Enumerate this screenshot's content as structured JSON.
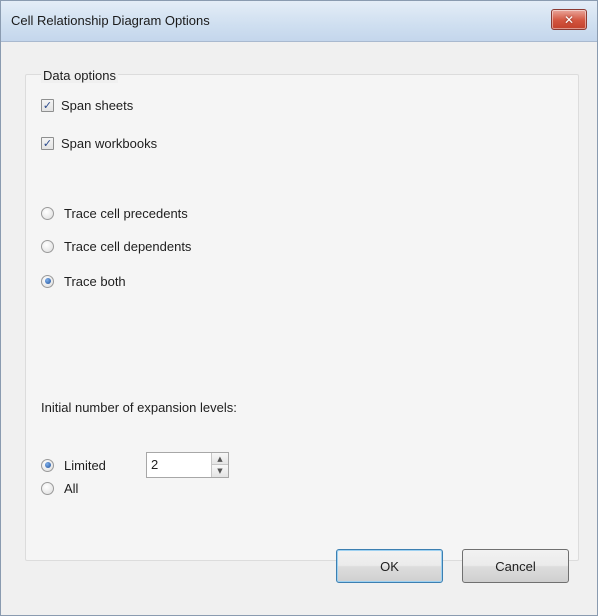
{
  "window": {
    "title": "Cell Relationship Diagram Options",
    "close_glyph": "✕"
  },
  "data_options": {
    "legend": "Data options",
    "span_sheets": {
      "label": "Span sheets",
      "checked": true
    },
    "span_workbooks": {
      "label": "Span workbooks",
      "checked": true
    }
  },
  "trace": {
    "selected": "both",
    "options": [
      {
        "id": "precedents",
        "label": "Trace cell precedents"
      },
      {
        "id": "dependents",
        "label": "Trace cell dependents"
      },
      {
        "id": "both",
        "label": "Trace both"
      }
    ]
  },
  "expansion": {
    "label": "Initial number of expansion levels:",
    "selected": "limited",
    "limited_label": "Limited",
    "all_label": "All",
    "levels_value": "2"
  },
  "buttons": {
    "ok": "OK",
    "cancel": "Cancel"
  },
  "icons": {
    "checkmark": "✓",
    "spin_up": "▲",
    "spin_down": "▼"
  }
}
